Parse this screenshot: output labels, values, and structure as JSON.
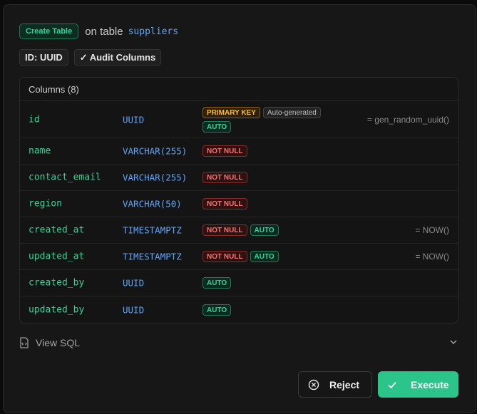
{
  "header": {
    "action_badge": "Create Table",
    "on_table_label": "on table",
    "table_name": "suppliers"
  },
  "tags": [
    "ID: UUID",
    "✓ Audit Columns"
  ],
  "columns_section": {
    "title": "Columns (8)",
    "rows": [
      {
        "name": "id",
        "type": "UUID",
        "badges": [
          "PRIMARY KEY",
          "Auto-generated",
          "AUTO"
        ],
        "default": "= gen_random_uuid()"
      },
      {
        "name": "name",
        "type": "VARCHAR(255)",
        "badges": [
          "NOT NULL"
        ],
        "default": ""
      },
      {
        "name": "contact_email",
        "type": "VARCHAR(255)",
        "badges": [
          "NOT NULL"
        ],
        "default": ""
      },
      {
        "name": "region",
        "type": "VARCHAR(50)",
        "badges": [
          "NOT NULL"
        ],
        "default": ""
      },
      {
        "name": "created_at",
        "type": "TIMESTAMPTZ",
        "badges": [
          "NOT NULL",
          "AUTO"
        ],
        "default": "= NOW()"
      },
      {
        "name": "updated_at",
        "type": "TIMESTAMPTZ",
        "badges": [
          "NOT NULL",
          "AUTO"
        ],
        "default": "= NOW()"
      },
      {
        "name": "created_by",
        "type": "UUID",
        "badges": [
          "AUTO"
        ],
        "default": ""
      },
      {
        "name": "updated_by",
        "type": "UUID",
        "badges": [
          "AUTO"
        ],
        "default": ""
      }
    ]
  },
  "view_sql": {
    "label": "View SQL",
    "icon": "code-file-icon",
    "toggle_icon": "chevron-down-icon"
  },
  "actions": {
    "reject_label": "Reject",
    "reject_icon": "x-circle-icon",
    "execute_label": "Execute",
    "execute_icon": "check-icon"
  },
  "colors": {
    "accent_green": "#2bc48a",
    "column_name": "#34d399",
    "column_type": "#60a5fa",
    "primary_key": "#fbbf24",
    "not_null": "#f87171"
  }
}
